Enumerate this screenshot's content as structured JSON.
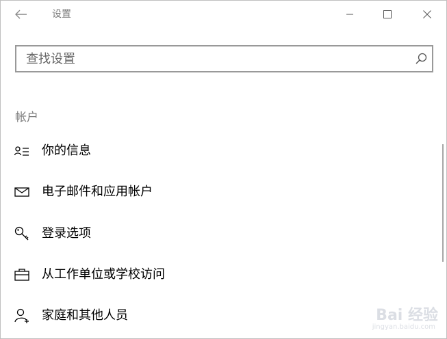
{
  "window": {
    "title": "设置"
  },
  "search": {
    "placeholder": "查找设置"
  },
  "section": {
    "title": "帐户"
  },
  "nav_items": [
    {
      "label": "你的信息",
      "icon": "user-info-icon"
    },
    {
      "label": "电子邮件和应用帐户",
      "icon": "mail-icon"
    },
    {
      "label": "登录选项",
      "icon": "key-icon"
    },
    {
      "label": "从工作单位或学校访问",
      "icon": "briefcase-icon"
    },
    {
      "label": "家庭和其他人员",
      "icon": "add-person-icon"
    }
  ],
  "watermark": {
    "text": "Bai 经验",
    "sub": "jingyan.baidu.com"
  },
  "colors": {
    "border": "#999999",
    "muted_text": "#7a7a7a",
    "scrollbar": "#a6a6a6"
  }
}
